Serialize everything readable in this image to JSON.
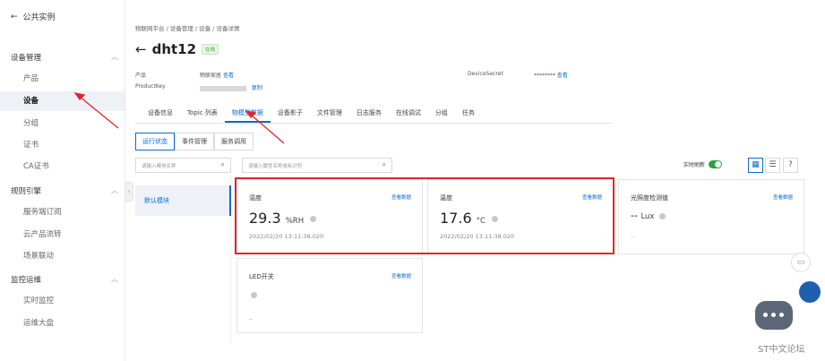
{
  "sidebar": {
    "back_label": "公共实例",
    "groups": [
      {
        "label": "设备管理",
        "items": [
          "产品",
          "设备",
          "分组",
          "证书",
          "CA证书"
        ]
      },
      {
        "label": "规则引擎",
        "items": [
          "服务端订阅",
          "云产品流转",
          "场景联动"
        ]
      },
      {
        "label": "监控运维",
        "items": [
          "实时监控",
          "运维大盘"
        ]
      }
    ],
    "active_item": "设备"
  },
  "breadcrumb": "物联网平台 / 设备管理 / 设备 / 设备详情",
  "device": {
    "name": "dht12",
    "status": "在线"
  },
  "meta": {
    "product_label": "产品",
    "product_value": "物联家居",
    "product_link": "查看",
    "productkey_label": "ProductKey",
    "productkey_link": "复制",
    "secret_label": "DeviceSecret",
    "secret_value": "********",
    "secret_link": "查看"
  },
  "tabs": [
    "设备信息",
    "Topic 列表",
    "物模型数据",
    "设备影子",
    "文件管理",
    "日志服务",
    "在线调试",
    "分组",
    "任务"
  ],
  "active_tab": "物模型数据",
  "subtabs": [
    "运行状态",
    "事件管理",
    "服务调用"
  ],
  "active_subtab": "运行状态",
  "search": {
    "module_placeholder": "请输入模块名称",
    "prop_placeholder": "请输入属性名称或标识符"
  },
  "refresh_label": "实时刷新",
  "help_label": "?",
  "module_default": "默认模块",
  "cards": [
    {
      "title": "湿度",
      "link": "查看数据",
      "value": "29.3",
      "unit": "%RH",
      "time": "2022/02/20 13:11:38.020"
    },
    {
      "title": "温度",
      "link": "查看数据",
      "value": "17.6",
      "unit": "°C",
      "time": "2022/02/20 13:11:38.020"
    },
    {
      "title": "光照度检测值",
      "link": "查看数据",
      "value": "--",
      "unit": "Lux",
      "time": "..."
    },
    {
      "title": "LED开关",
      "link": "查看数据",
      "value": "",
      "unit": "",
      "time": "--"
    }
  ],
  "watermark": "ST中文论坛",
  "colors": {
    "accent": "#0b6bd6",
    "highlight": "#e0262b",
    "online": "#3aa13a"
  }
}
